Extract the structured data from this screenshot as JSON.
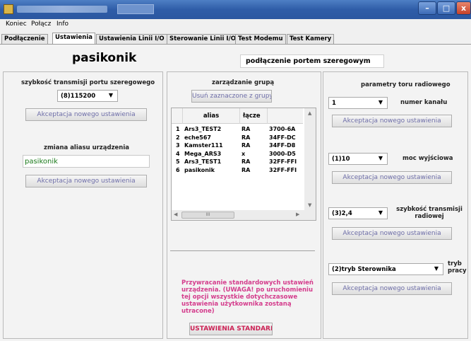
{
  "window": {
    "minimize": "–",
    "maximize": "□",
    "close": "x"
  },
  "menu": [
    "Koniec",
    "Połącz",
    "Info"
  ],
  "tabs": [
    "Podłączenie",
    "Ustawienia",
    "Ustawienia Linii I/O",
    "Sterowanie Linii I/O",
    "Test Modemu",
    "Test Kamery"
  ],
  "header": {
    "device_name": "pasikonik",
    "connection_type": "podłączenie portem szeregowym"
  },
  "left": {
    "baud_label": "szybkość transmisji portu szeregowego",
    "baud_value": "(8)115200",
    "accept_baud": "Akceptacja nowego ustawienia",
    "alias_label": "zmiana aliasu urządzenia",
    "alias_value": "pasikonik",
    "accept_alias": "Akceptacja nowego ustawienia"
  },
  "middle": {
    "group_label": "zarządzanie grupą",
    "remove_button": "Usuń zaznaczone z grupy",
    "columns": [
      "",
      "alias",
      "łącze",
      ""
    ],
    "rows": [
      [
        "1",
        "Ars3_TEST2",
        "RA",
        "3700-6A"
      ],
      [
        "2",
        "eche567",
        "RA",
        "34FF-DC"
      ],
      [
        "3",
        "Kamster111",
        "RA",
        "34FF-D8"
      ],
      [
        "4",
        "Mega_ARS3",
        "x",
        "3000-D5"
      ],
      [
        "5",
        "Ars3_TEST1",
        "RA",
        "32FF-FFI"
      ],
      [
        "6",
        "pasikonik",
        "RA",
        "32FF-FFI"
      ]
    ],
    "scroll_thumb": "III",
    "warning": "Przywracanie standardowych ustawień urządzenia. (UWAGA! po uruchomieniu tej opcji wszystkie dotychczasowe ustawienia użytkownika zostaną utracone)",
    "defaults_button": "USTAWIENIA STANDARDOWE"
  },
  "right": {
    "title": "parametry toru radiowego",
    "channel_value": "1",
    "channel_label": "numer kanału",
    "accept_channel": "Akceptacja nowego ustawienia",
    "power_value": "(1)10",
    "power_label": "moc wyjściowa",
    "accept_power": "Akceptacja nowego ustawienia",
    "radio_speed_value": "(3)2,4",
    "radio_speed_label": "szybkość transmisji radiowej",
    "accept_radio_speed": "Akceptacja nowego ustawienia",
    "mode_value": "(2)tryb Sterownika",
    "mode_label": "tryb pracy",
    "accept_mode": "Akceptacja nowego ustawienia"
  }
}
